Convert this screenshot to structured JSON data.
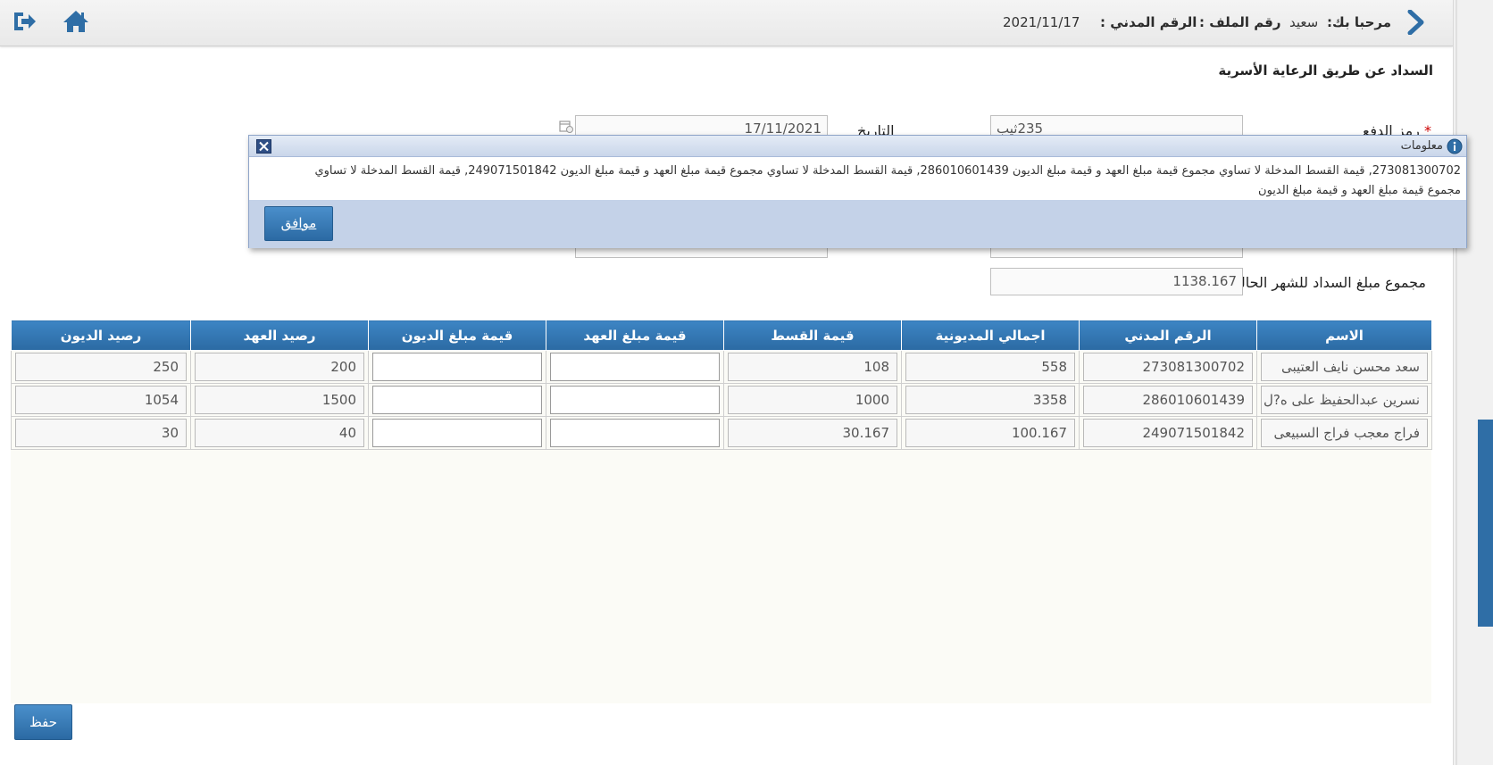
{
  "header": {
    "welcome_label": "مرحبا بك:",
    "user_name": "سعيد",
    "file_no_label": "رقم الملف :",
    "civil_id_label": "الرقم المدني :",
    "date": "2021/11/17"
  },
  "page_title": "السداد عن طريق الرعاية الأسرية",
  "form": {
    "payment_code_label": "رمز الدفع",
    "payment_code_value": "235ثيب",
    "date_label": "التاريخ",
    "date_value": "17/11/2021",
    "total_label": "مجموع مبلغ السداد للشهر الحالي",
    "total_value": "1138.167"
  },
  "grid": {
    "columns": [
      "الاسم",
      "الرقم المدني",
      "اجمالي المديونية",
      "قيمة القسط",
      "قيمة مبلغ العهد",
      "قيمة مبلغ الديون",
      "رصيد العهد",
      "رصيد الديون"
    ],
    "rows": [
      {
        "name": "سعد محسن نايف العتيبى",
        "civil_id": "273081300702",
        "total_debt": "558",
        "installment": "108",
        "custody_amount": "",
        "debt_amount": "",
        "custody_balance": "200",
        "debt_balance": "250"
      },
      {
        "name": "نسرين عبدالحفيظ على ه?ل",
        "civil_id": "286010601439",
        "total_debt": "3358",
        "installment": "1000",
        "custody_amount": "",
        "debt_amount": "",
        "custody_balance": "1500",
        "debt_balance": "1054"
      },
      {
        "name": "فراج معجب فراج السبيعى",
        "civil_id": "249071501842",
        "total_debt": "100.167",
        "installment": "30.167",
        "custody_amount": "",
        "debt_amount": "",
        "custody_balance": "40",
        "debt_balance": "30"
      }
    ]
  },
  "save_button": "حفظ",
  "dialog": {
    "title": "معلومات",
    "message": "273081300702, قيمة القسط المدخلة لا تساوي مجموع قيمة مبلغ العهد و قيمة مبلغ الديون 286010601439, قيمة القسط المدخلة لا تساوي مجموع قيمة مبلغ العهد و قيمة مبلغ الديون 249071501842, قيمة القسط المدخلة لا تساوي مجموع قيمة مبلغ العهد و قيمة مبلغ الديون",
    "ok_button": "موافق"
  },
  "icons": [
    "logout-icon",
    "home-icon",
    "back-chevron-icon",
    "calendar-icon",
    "info-icon",
    "close-icon"
  ],
  "colors": {
    "header_blue": "#2f6ea6",
    "accent": "#3d85c4",
    "required": "#cc0000"
  }
}
